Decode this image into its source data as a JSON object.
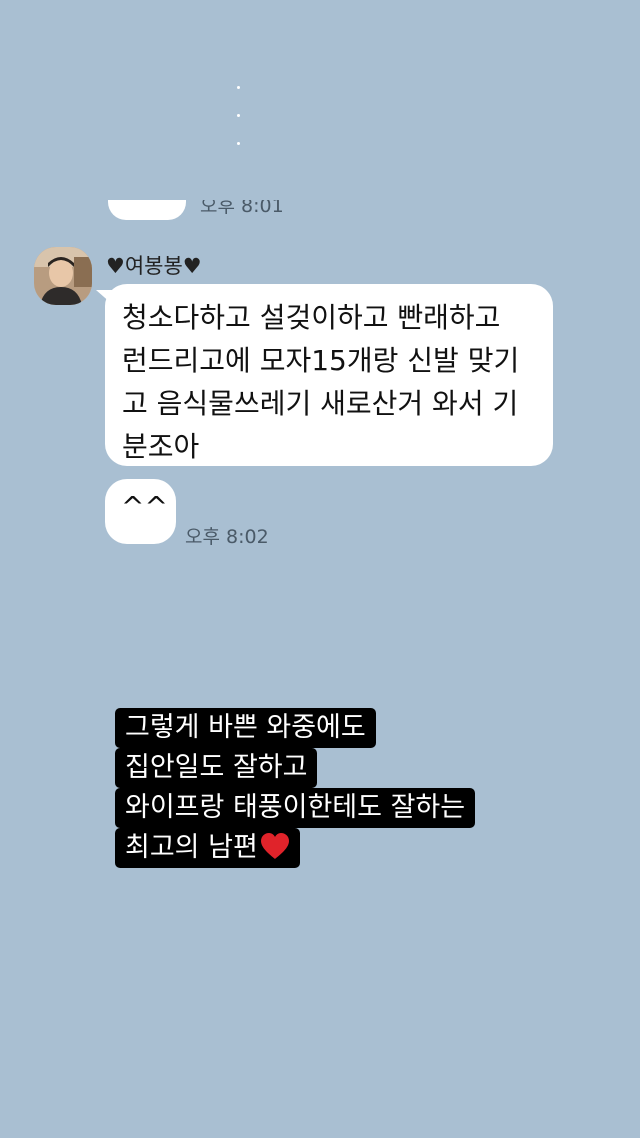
{
  "previous_message": {
    "time": "오후 8:01"
  },
  "sender": {
    "name": "♥여봉봉♥",
    "avatar": "avatar-photo"
  },
  "messages": [
    {
      "lines": [
        "청소다하고 설겆이하고 빤래하고",
        "런드리고에 모자15개랑 신발 맞기",
        "고 음식물쓰레기 새로산거 와서 기",
        "분조아"
      ]
    },
    {
      "text": "^^",
      "time": "오후 8:02"
    }
  ],
  "caption": {
    "lines": [
      "그렇게 바쁜 와중에도",
      "집안일도 잘하고",
      "와이프랑 태풍이한테도 잘하는",
      "최고의 남편"
    ],
    "end_icon": "red-heart-icon"
  },
  "colors": {
    "background": "#a9bfd2",
    "bubble": "#ffffff",
    "caption_bg": "#000000",
    "caption_text": "#ffffff",
    "heart": "#e0232a"
  }
}
